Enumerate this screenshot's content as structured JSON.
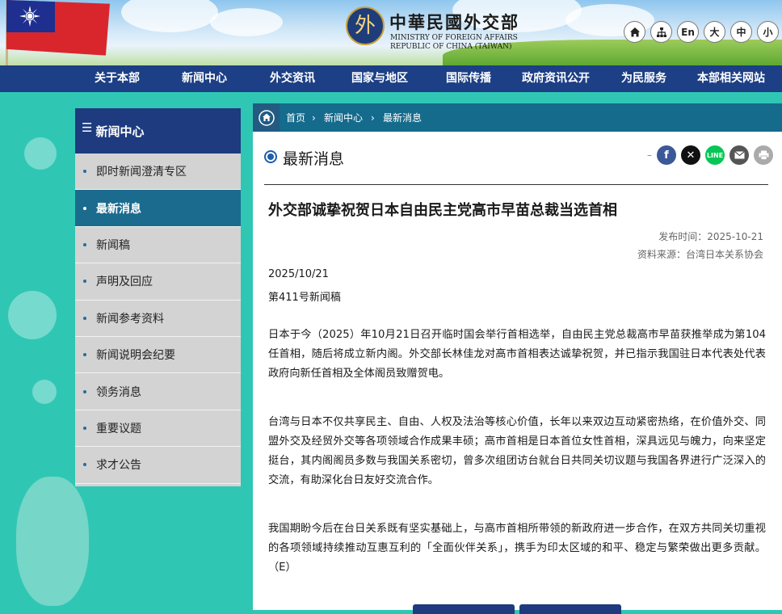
{
  "header": {
    "ministry_cn": "中華民國外交部",
    "ministry_en_1": "MINISTRY OF FOREIGN AFFAIRS",
    "ministry_en_2": "REPUBLIC OF CHINA (TAIWAN)",
    "tools": [
      {
        "icon": "home-icon"
      },
      {
        "icon": "sitemap-icon"
      },
      {
        "label": "En"
      },
      {
        "label": "大"
      },
      {
        "label": "中"
      },
      {
        "label": "小"
      }
    ]
  },
  "nav": [
    "关于本部",
    "新闻中心",
    "外交资讯",
    "国家与地区",
    "国际传播",
    "政府资讯公开",
    "为民服务",
    "本部相关网站"
  ],
  "sidebar": {
    "title": "新闻中心",
    "items": [
      {
        "label": "即时新闻澄清专区",
        "active": false
      },
      {
        "label": "最新消息",
        "active": true
      },
      {
        "label": "新闻稿",
        "active": false
      },
      {
        "label": "声明及回应",
        "active": false
      },
      {
        "label": "新闻参考资料",
        "active": false
      },
      {
        "label": "新闻说明会纪要",
        "active": false
      },
      {
        "label": "领务消息",
        "active": false
      },
      {
        "label": "重要议题",
        "active": false
      },
      {
        "label": "求才公告",
        "active": false
      }
    ]
  },
  "breadcrumb": [
    "首页",
    "新闻中心",
    "最新消息"
  ],
  "section_title": "最新消息",
  "share_icons": [
    "facebook-icon",
    "x-icon",
    "line-icon",
    "mail-icon",
    "print-icon"
  ],
  "colors": {
    "nav": "#1c3f85",
    "active": "#1a6b8e",
    "crumbbar": "#156b8c",
    "page_bg": "#2fc7b4"
  },
  "article": {
    "title": "外交部诚挚祝贺日本自由民主党高市早苗总裁当选首相",
    "published": "发布时间：2025-10-21",
    "source": "资料来源：台湾日本关系协会",
    "date": "2025/10/21",
    "number": "第411号新闻稿",
    "paragraphs": [
      "日本于今（2025）年10月21日召开临时国会举行首相选举，自由民主党总裁高市早苗获推举成为第104任首相，随后将成立新内阁。外交部长林佳龙对高市首相表达诚挚祝贺，并已指示我国驻日本代表处代表政府向新任首相及全体阁员致赠贺电。",
      "台湾与日本不仅共享民主、自由、人权及法治等核心价值，长年以来双边互动紧密热络，在价值外交、同盟外交及经贸外交等各项领域合作成果丰硕；高市首相是日本首位女性首相，深具远见与魄力，向来坚定挺台，其内阁阁员多数与我国关系密切，曾多次组团访台就台日共同关切议题与我国各界进行广泛深入的交流，有助深化台日友好交流合作。",
      "我国期盼今后在台日关系既有坚实基础上，与高市首相所带领的新政府进一步合作，在双方共同关切重视的各项领域持续推动互惠互利的「全面伙伴关系」，携手为印太区域的和平、稳定与繁荣做出更多贡献。（E）"
    ]
  }
}
